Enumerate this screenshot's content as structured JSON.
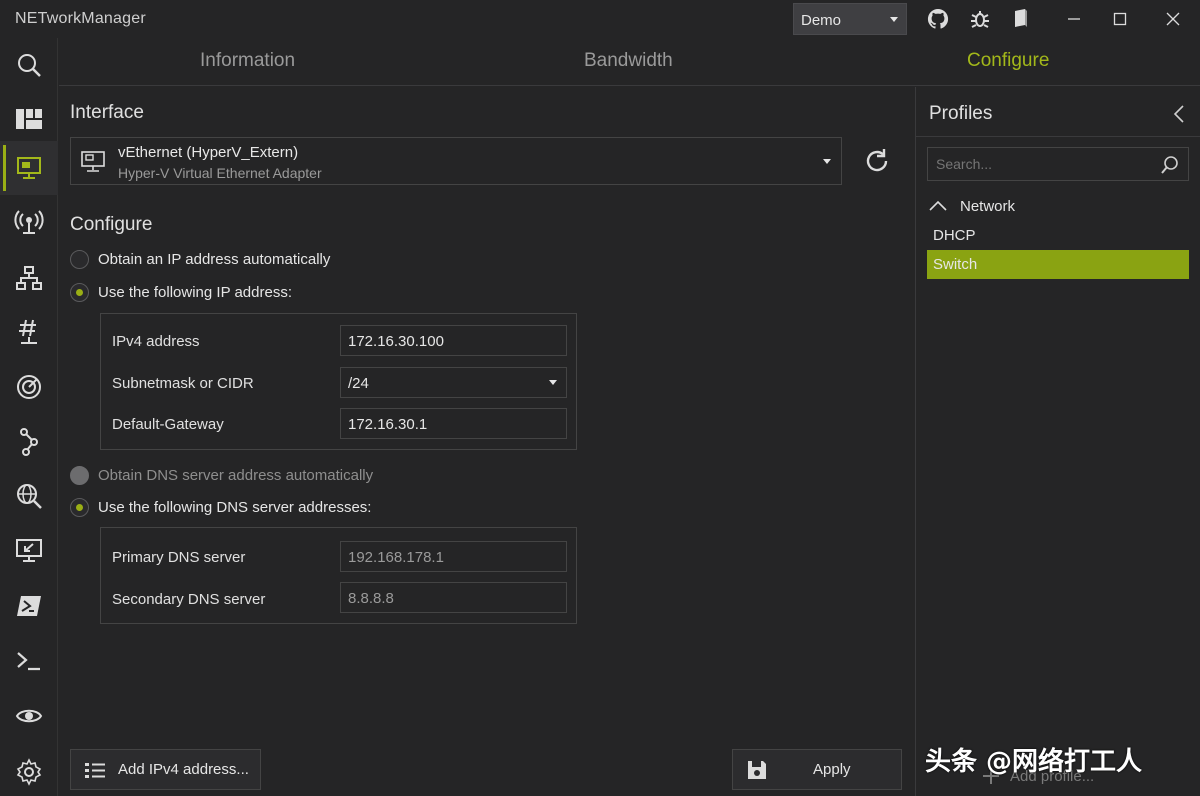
{
  "app": {
    "title": "NETworkManager"
  },
  "titlebar": {
    "profile_file": "Demo"
  },
  "nav": {
    "items": [
      "search-icon",
      "dashboard-icon",
      "network-interface-icon",
      "wifi-icon",
      "ip-scanner-icon",
      "subnet-icon",
      "port-scanner-icon",
      "traceroute-icon",
      "dns-lookup-icon",
      "remote-desktop-icon",
      "powershell-icon",
      "terminal-icon",
      "eye-icon",
      "settings-icon"
    ],
    "active": "network-interface-icon"
  },
  "tabs": [
    {
      "label": "Information"
    },
    {
      "label": "Bandwidth"
    },
    {
      "label": "Configure"
    }
  ],
  "interface": {
    "section_title": "Interface",
    "name": "vEthernet (HyperV_Extern)",
    "description": "Hyper-V Virtual Ethernet Adapter"
  },
  "configure": {
    "section_title": "Configure",
    "ip_auto_label": "Obtain an IP address automatically",
    "ip_static_label": "Use the following IP address:",
    "ipv4_label": "IPv4 address",
    "ipv4_value": "172.16.30.100",
    "subnet_label": "Subnetmask or CIDR",
    "subnet_value": "/24",
    "gateway_label": "Default-Gateway",
    "gateway_value": "172.16.30.1",
    "dns_auto_label": "Obtain DNS server address automatically",
    "dns_static_label": "Use the following DNS server addresses:",
    "dns_primary_label": "Primary DNS server",
    "dns_primary_value": "192.168.178.1",
    "dns_secondary_label": "Secondary DNS server",
    "dns_secondary_value": "8.8.8.8"
  },
  "buttons": {
    "add_ipv4": "Add IPv4 address...",
    "apply": "Apply"
  },
  "profiles": {
    "title": "Profiles",
    "search_placeholder": "Search...",
    "group": "Network",
    "items": [
      "DHCP",
      "Switch"
    ],
    "selected": "Switch",
    "add_label": "Add profile..."
  },
  "watermark": "头条 @网络打工人",
  "colors": {
    "accent": "#9aaf15",
    "background": "#252526"
  }
}
